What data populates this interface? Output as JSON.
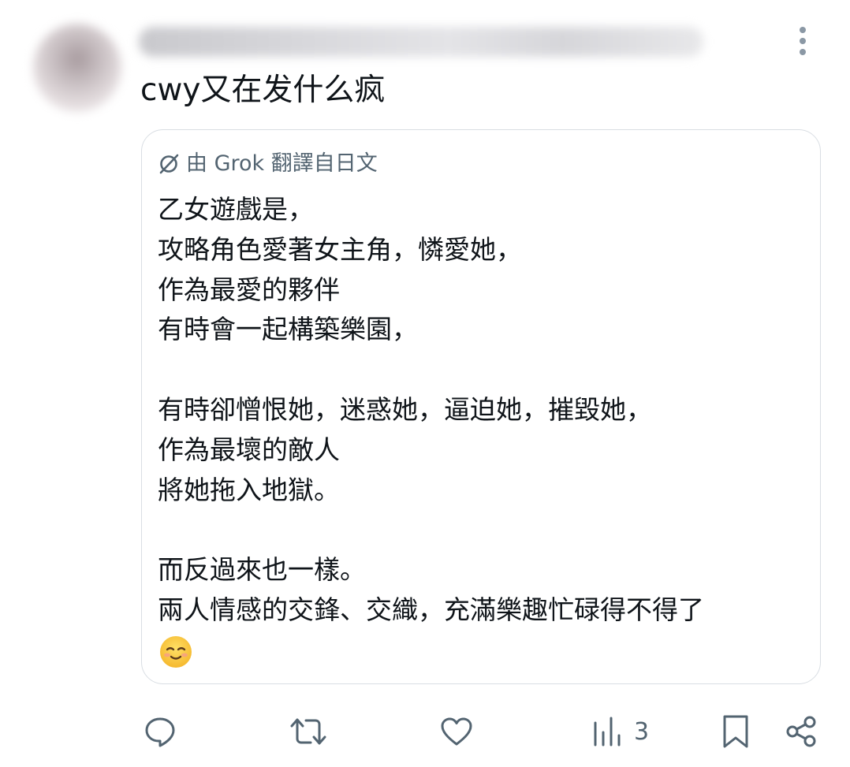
{
  "post": {
    "text": "cwy又在发什么疯"
  },
  "quote": {
    "translation_note": "由 Grok 翻譯自日文",
    "body": "乙女遊戲是，\n攻略角色愛著女主角，憐愛她，\n作為最愛的夥伴\n有時會一起構築樂園，\n\n有時卻憎恨她，迷惑她，逼迫她，摧毀她，\n作為最壞的敵人\n將她拖入地獄。\n\n而反過來也一樣。\n兩人情感的交鋒、交織，充滿樂趣忙碌得不得了"
  },
  "actions": {
    "views_count": "3"
  },
  "icons": {
    "more": "more-vertical-icon",
    "translate": "grok-translate-icon",
    "emoji": "smiling-face-emoji",
    "reply": "reply-icon",
    "repost": "repost-icon",
    "like": "heart-icon",
    "views": "views-icon",
    "bookmark": "bookmark-icon",
    "share": "share-icon"
  },
  "colors": {
    "text": "#0f1419",
    "secondary": "#536471",
    "border": "#d9dee3"
  }
}
